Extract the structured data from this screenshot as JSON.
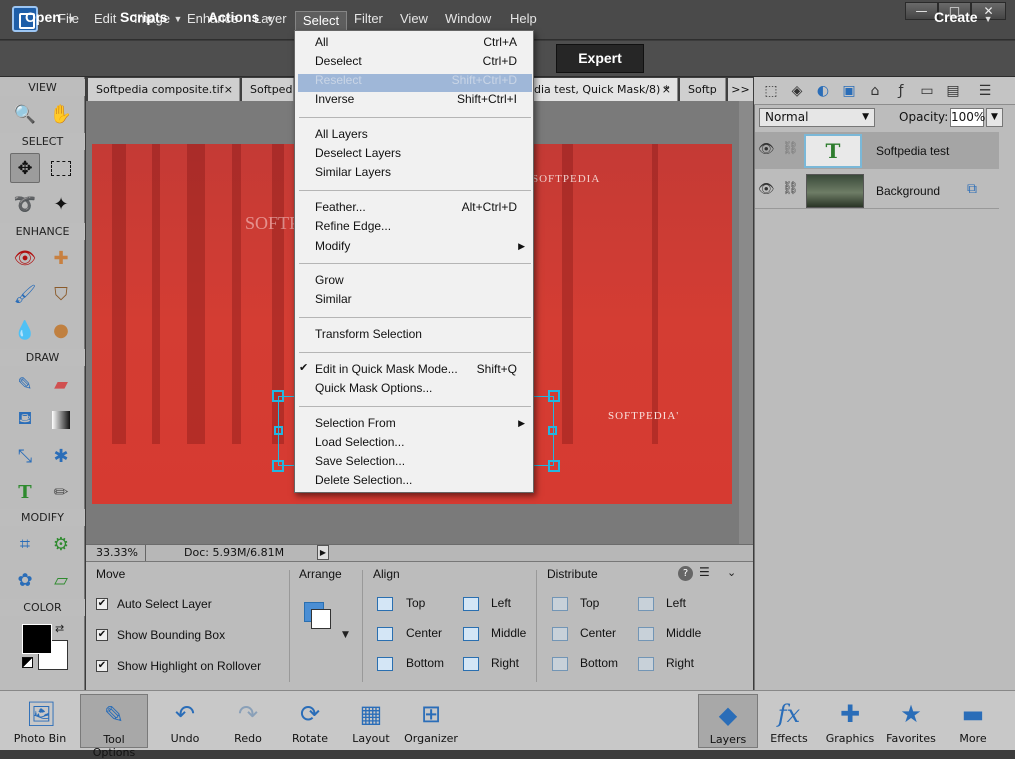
{
  "menubar": {
    "items": [
      "File",
      "Edit",
      "Image",
      "Enhance",
      "Layer",
      "Select",
      "Filter",
      "View",
      "Window",
      "Help"
    ],
    "window_buttons": [
      "—",
      "□",
      "✕"
    ]
  },
  "modebar": {
    "open": "Open",
    "scripts": "Scripts",
    "actions": "Actions",
    "expert": "Expert",
    "create": "Create"
  },
  "toolbox": {
    "sections": [
      "VIEW",
      "SELECT",
      "ENHANCE",
      "DRAW",
      "MODIFY",
      "COLOR"
    ]
  },
  "tabs": [
    {
      "label": "Softpedia composite.tif",
      "close": "×"
    },
    {
      "label": "Softpedi",
      "close": ""
    },
    {
      "label": "dia test, Quick Mask/8) *",
      "close": "×"
    },
    {
      "label": "Softp",
      "close": ""
    }
  ],
  "tabs_overflow": ">>",
  "canvas": {
    "watermark_top": "SOFTPEDIA",
    "watermark_right": "SOFTPEDIA'",
    "watermark_left": "SOFTP"
  },
  "status": {
    "zoom": "33.33%",
    "doc": "Doc: 5.93M/6.81M"
  },
  "options": {
    "move": "Move",
    "checks": [
      {
        "label": "Auto Select Layer",
        "checked": true
      },
      {
        "label": "Show Bounding Box",
        "checked": true
      },
      {
        "label": "Show Highlight on Rollover",
        "checked": true
      }
    ],
    "arrange": "Arrange",
    "align": {
      "title": "Align",
      "items": [
        "Top",
        "Center",
        "Bottom",
        "Left",
        "Middle",
        "Right"
      ]
    },
    "distribute": {
      "title": "Distribute",
      "items": [
        "Top",
        "Center",
        "Bottom",
        "Left",
        "Middle",
        "Right"
      ]
    }
  },
  "layers_panel": {
    "blend_mode": "Normal",
    "opacity_label": "Opacity:",
    "opacity": "100%",
    "layers": [
      {
        "name": "Softpedia test",
        "type": "text"
      },
      {
        "name": "Background",
        "type": "image"
      }
    ]
  },
  "bottombar": {
    "left": [
      "Photo Bin",
      "Tool Options",
      "Undo",
      "Redo",
      "Rotate",
      "Layout",
      "Organizer"
    ],
    "right": [
      "Layers",
      "Effects",
      "Graphics",
      "Favorites",
      "More"
    ]
  },
  "select_menu": {
    "groups": [
      [
        {
          "label": "All",
          "shortcut": "Ctrl+A"
        },
        {
          "label": "Deselect",
          "shortcut": "Ctrl+D"
        },
        {
          "label": "Reselect",
          "shortcut": "Shift+Ctrl+D",
          "disabled": true
        },
        {
          "label": "Inverse",
          "shortcut": "Shift+Ctrl+I"
        }
      ],
      [
        {
          "label": "All Layers"
        },
        {
          "label": "Deselect Layers"
        },
        {
          "label": "Similar Layers"
        }
      ],
      [
        {
          "label": "Feather...",
          "shortcut": "Alt+Ctrl+D"
        },
        {
          "label": "Refine Edge..."
        },
        {
          "label": "Modify",
          "submenu": true
        }
      ],
      [
        {
          "label": "Grow"
        },
        {
          "label": "Similar"
        }
      ],
      [
        {
          "label": "Transform Selection"
        }
      ],
      [
        {
          "label": "Edit in Quick Mask Mode...",
          "shortcut": "Shift+Q",
          "checked": true
        },
        {
          "label": "Quick Mask Options..."
        }
      ],
      [
        {
          "label": "Selection From",
          "submenu": true
        },
        {
          "label": "Load Selection..."
        },
        {
          "label": "Save Selection..."
        },
        {
          "label": "Delete Selection..."
        }
      ]
    ]
  },
  "colors": {
    "accent": "#24b6e0",
    "menu_highlight": "#9fb7d8",
    "canvas_red": "#d43d33"
  }
}
